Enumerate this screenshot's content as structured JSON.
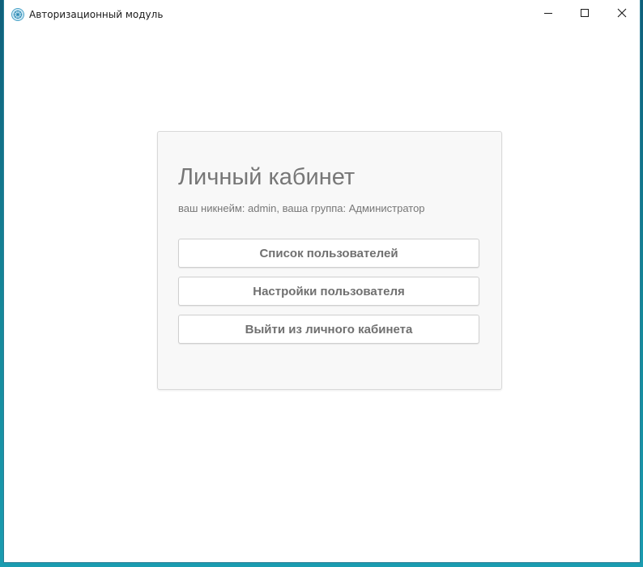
{
  "window": {
    "title": "Авторизационный модуль",
    "icon": "app-logo-icon",
    "controls": {
      "minimize": "minimize-icon",
      "maximize": "maximize-icon",
      "close": "close-icon"
    }
  },
  "card": {
    "title": "Личный кабинет",
    "subtitle": "ваш никнейм: admin, ваша группа: Администратор",
    "buttons": [
      {
        "label": "Список пользователей"
      },
      {
        "label": "Настройки пользователя"
      },
      {
        "label": "Выйти из личного кабинета"
      }
    ]
  }
}
